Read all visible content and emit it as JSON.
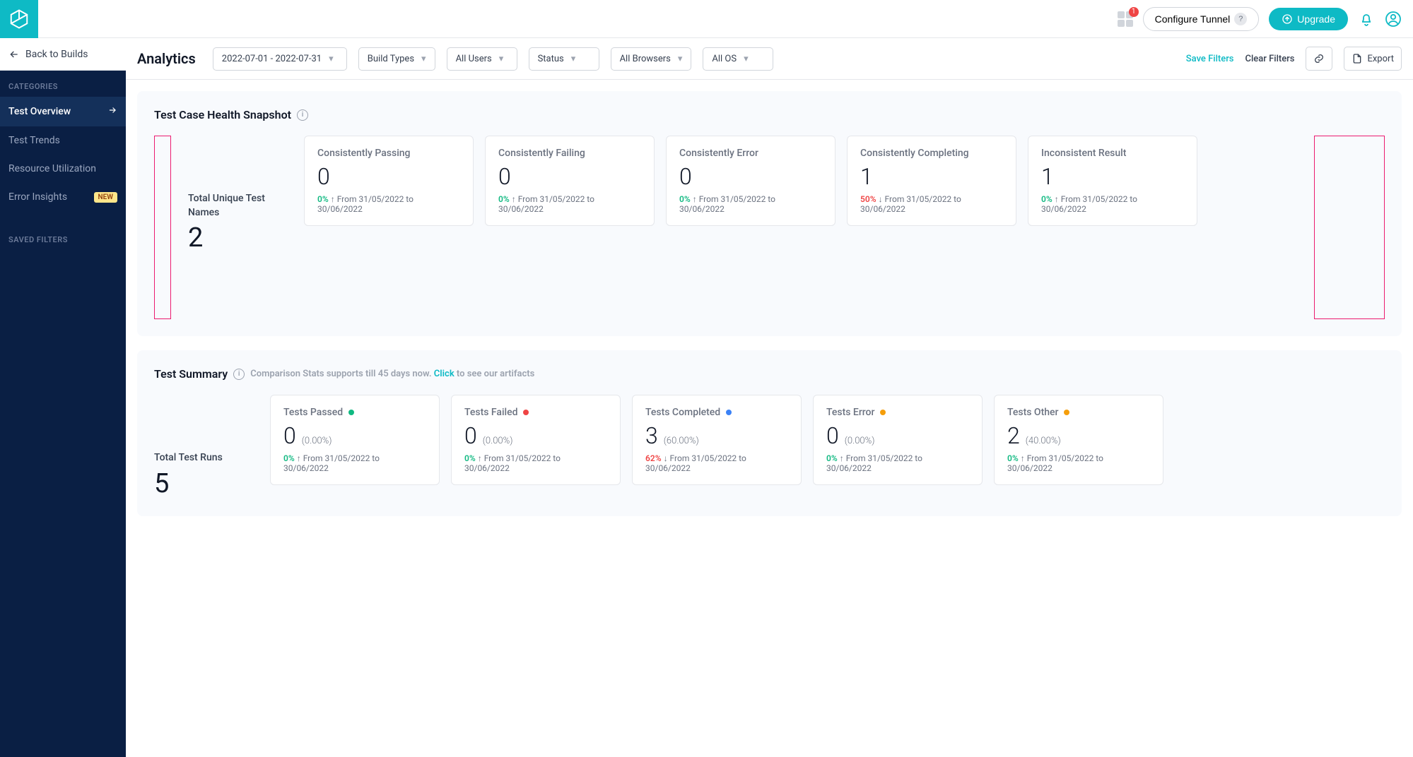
{
  "topbar": {
    "app_badge": "1",
    "configure_tunnel": "Configure Tunnel",
    "upgrade": "Upgrade"
  },
  "sidebar": {
    "back": "Back to Builds",
    "categories_heading": "CATEGORIES",
    "saved_filters_heading": "SAVED FILTERS",
    "items": {
      "overview": "Test Overview",
      "trends": "Test Trends",
      "resource": "Resource Utilization",
      "errors": "Error Insights",
      "new_badge": "NEW"
    }
  },
  "toolbar": {
    "title": "Analytics",
    "date_range": "2022-07-01 - 2022-07-31",
    "build_types": "Build Types",
    "all_users": "All Users",
    "status": "Status",
    "all_browsers": "All Browsers",
    "all_os": "All OS",
    "save_filters": "Save Filters",
    "clear_filters": "Clear Filters",
    "export": "Export"
  },
  "snapshot": {
    "title": "Test Case Health Snapshot",
    "total_label": "Total Unique Test Names",
    "total_value": "2",
    "cards": {
      "passing": {
        "title": "Consistently Passing",
        "value": "0",
        "delta": "0%",
        "dir": "up",
        "color": "green",
        "range": "From 31/05/2022 to 30/06/2022"
      },
      "failing": {
        "title": "Consistently Failing",
        "value": "0",
        "delta": "0%",
        "dir": "up",
        "color": "green",
        "range": "From 31/05/2022 to 30/06/2022"
      },
      "error": {
        "title": "Consistently Error",
        "value": "0",
        "delta": "0%",
        "dir": "up",
        "color": "green",
        "range": "From 31/05/2022 to 30/06/2022"
      },
      "completing": {
        "title": "Consistently Completing",
        "value": "1",
        "delta": "50%",
        "dir": "down",
        "color": "red",
        "range": "From 31/05/2022 to 30/06/2022"
      },
      "inconsist": {
        "title": "Inconsistent Result",
        "value": "1",
        "delta": "0%",
        "dir": "up",
        "color": "green",
        "range": "From 31/05/2022 to 30/06/2022"
      }
    }
  },
  "summary": {
    "title": "Test Summary",
    "subtext_pre": "Comparison Stats supports till 45 days now. ",
    "subtext_link": "Click",
    "subtext_post": " to see our artifacts",
    "total_label": "Total Test Runs",
    "total_value": "5",
    "cards": {
      "passed": {
        "title": "Tests Passed",
        "value": "0",
        "pct": "(0.00%)",
        "delta": "0%",
        "dir": "up",
        "color": "green",
        "dot": "green",
        "range": "From 31/05/2022 to 30/06/2022"
      },
      "failed": {
        "title": "Tests Failed",
        "value": "0",
        "pct": "(0.00%)",
        "delta": "0%",
        "dir": "up",
        "color": "green",
        "dot": "red",
        "range": "From 31/05/2022 to 30/06/2022"
      },
      "completed": {
        "title": "Tests Completed",
        "value": "3",
        "pct": "(60.00%)",
        "delta": "62%",
        "dir": "down",
        "color": "red",
        "dot": "blue",
        "range": "From 31/05/2022 to 30/06/2022"
      },
      "error": {
        "title": "Tests Error",
        "value": "0",
        "pct": "(0.00%)",
        "delta": "0%",
        "dir": "up",
        "color": "green",
        "dot": "orange",
        "range": "From 31/05/2022 to 30/06/2022"
      },
      "other": {
        "title": "Tests Other",
        "value": "2",
        "pct": "(40.00%)",
        "delta": "0%",
        "dir": "up",
        "color": "green",
        "dot": "orange",
        "range": "From 31/05/2022 to 30/06/2022"
      }
    }
  }
}
